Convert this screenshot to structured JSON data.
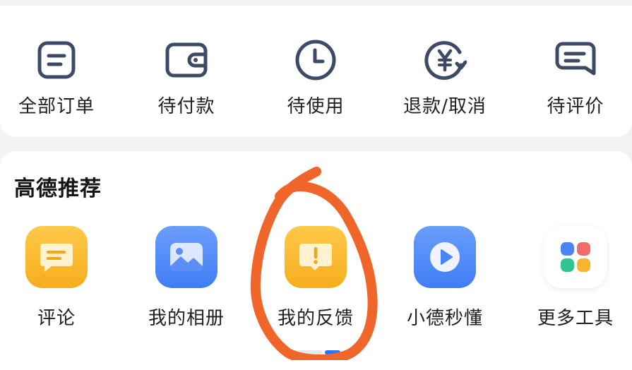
{
  "orders": {
    "items": [
      {
        "label": "全部订单",
        "icon": "order-list-icon"
      },
      {
        "label": "待付款",
        "icon": "wallet-icon"
      },
      {
        "label": "待使用",
        "icon": "clock-icon"
      },
      {
        "label": "退款/取消",
        "icon": "refund-yen-icon"
      },
      {
        "label": "待评价",
        "icon": "comment-icon"
      }
    ]
  },
  "recommend": {
    "title": "高德推荐",
    "items": [
      {
        "label": "评论",
        "icon": "comment-bubble-icon"
      },
      {
        "label": "我的相册",
        "icon": "photo-album-icon"
      },
      {
        "label": "我的反馈",
        "icon": "feedback-icon"
      },
      {
        "label": "小德秒懂",
        "icon": "play-icon"
      },
      {
        "label": "更多工具",
        "icon": "grid-tools-icon"
      }
    ]
  },
  "colors": {
    "order_icon_stroke": "#3d4a66",
    "accent_yellow": "#f6ad1c",
    "accent_blue": "#3f7df5",
    "annotation_orange": "#f0652a"
  }
}
